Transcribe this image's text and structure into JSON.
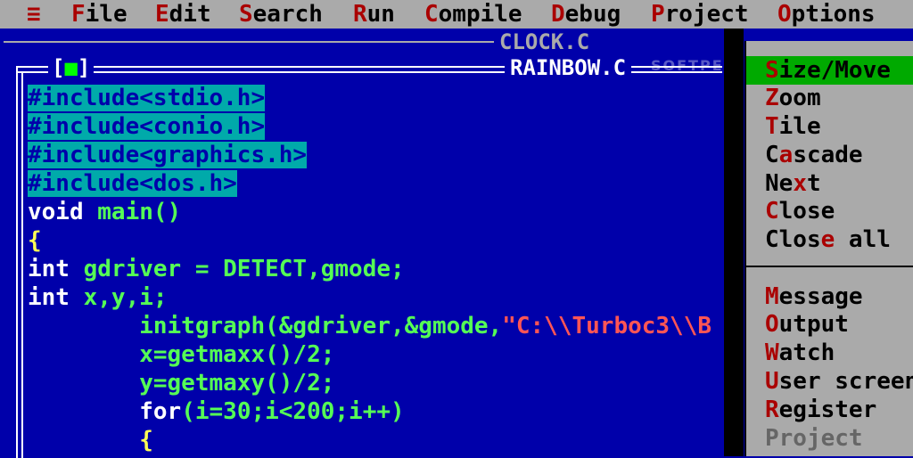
{
  "menubar": {
    "system": "≡",
    "items": [
      {
        "hot": "F",
        "rest": "ile"
      },
      {
        "hot": "E",
        "rest": "dit"
      },
      {
        "hot": "S",
        "rest": "earch"
      },
      {
        "hot": "R",
        "rest": "un"
      },
      {
        "hot": "C",
        "rest": "ompile"
      },
      {
        "hot": "D",
        "rest": "ebug"
      },
      {
        "hot": "P",
        "rest": "roject"
      },
      {
        "hot": "O",
        "rest": "ptions"
      }
    ]
  },
  "windows": {
    "back_title": "CLOCK.C",
    "front_title": "RAINBOW.C",
    "close_left": "[",
    "close_dot": "■",
    "close_right": "]"
  },
  "watermark": "SOFTPEDIA",
  "code": {
    "l1": "#include<stdio.h>",
    "l2": "#include<conio.h>",
    "l3": "#include<graphics.h>",
    "l4": "#include<dos.h>",
    "l5a": "void ",
    "l5b": "main()",
    "l6": "{",
    "l7a": "int ",
    "l7b": "gdriver = DETECT,gmode;",
    "l8a": "int ",
    "l8b": "x,y,i;",
    "l9a": "        initgraph(&gdriver,&gmode,",
    "l9b": "\"C:\\\\Turboc3\\\\B",
    "l10": "        x=getmaxx()/2;",
    "l11": "        y=getmaxy()/2;",
    "l12a": "        ",
    "l12b": "for",
    "l12c": "(i=30;i<200;i++)",
    "l13": "        {"
  },
  "window_menu": {
    "items": [
      {
        "pre": "",
        "hot": "S",
        "rest": "ize/Move"
      },
      {
        "pre": "",
        "hot": "Z",
        "rest": "oom"
      },
      {
        "pre": "",
        "hot": "T",
        "rest": "ile"
      },
      {
        "pre": "C",
        "hot": "a",
        "rest": "scade"
      },
      {
        "pre": "Ne",
        "hot": "x",
        "rest": "t"
      },
      {
        "pre": "",
        "hot": "C",
        "rest": "lose"
      },
      {
        "pre": "Clos",
        "hot": "e",
        "rest": " all"
      },
      {
        "pre": "",
        "hot": "M",
        "rest": "essage"
      },
      {
        "pre": "",
        "hot": "O",
        "rest": "utput"
      },
      {
        "pre": "",
        "hot": "W",
        "rest": "atch"
      },
      {
        "pre": "",
        "hot": "U",
        "rest": "ser screen"
      },
      {
        "pre": "",
        "hot": "R",
        "rest": "egister"
      },
      {
        "pre": "",
        "hot": "",
        "rest": "Project"
      }
    ]
  },
  "colors": {
    "desktop": "#0000aa",
    "menubar": "#aaaaaa",
    "hotkey": "#aa0000",
    "selection": "#00aaaa",
    "menu_highlight": "#00aa00"
  }
}
